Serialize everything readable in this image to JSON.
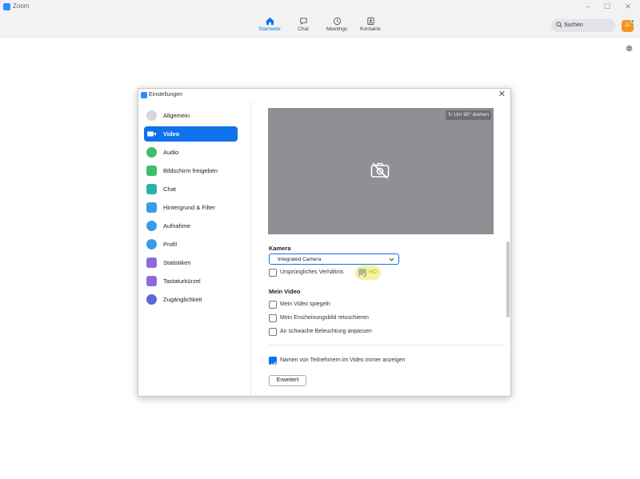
{
  "app": {
    "title": "Zoom"
  },
  "window_controls": {
    "minimize": "–",
    "maximize": "☐",
    "close": "✕"
  },
  "topnav": {
    "items": [
      {
        "label": "Startseite",
        "icon": "home-icon",
        "active": true
      },
      {
        "label": "Chat",
        "icon": "chat-icon",
        "active": false
      },
      {
        "label": "Meetings",
        "icon": "clock-icon",
        "active": false
      },
      {
        "label": "Kontakte",
        "icon": "contacts-icon",
        "active": false
      }
    ],
    "search_label": "Suchen",
    "avatar_initials": "JL"
  },
  "colors": {
    "accent": "#0e72ed",
    "brand": "#2d8cff",
    "avatar": "#f7941d",
    "online": "#20c05c",
    "highlight": "#f6f39a"
  },
  "dialog": {
    "title": "Einstellungen",
    "close": "✕",
    "sidebar": [
      {
        "label": "Allgemein",
        "icon": "gear-icon",
        "color": "#c9c9cf"
      },
      {
        "label": "Video",
        "icon": "video-camera-icon",
        "color": "#ffffff",
        "active": true
      },
      {
        "label": "Audio",
        "icon": "headphones-icon",
        "color": "#3cbf6a"
      },
      {
        "label": "Bildschirm freigeben",
        "icon": "share-screen-icon",
        "color": "#3cbf6a"
      },
      {
        "label": "Chat",
        "icon": "chat-bubble-icon",
        "color": "#2bb3a3"
      },
      {
        "label": "Hintergrund & Filter",
        "icon": "background-icon",
        "color": "#3a9be8"
      },
      {
        "label": "Aufnahme",
        "icon": "record-icon",
        "color": "#3a9be8"
      },
      {
        "label": "Profil",
        "icon": "profile-icon",
        "color": "#3a9be8"
      },
      {
        "label": "Statistiken",
        "icon": "statistics-icon",
        "color": "#8e6ad8"
      },
      {
        "label": "Tastaturkürzel",
        "icon": "keyboard-icon",
        "color": "#8e6ad8"
      },
      {
        "label": "Zugänglichkeit",
        "icon": "accessibility-icon",
        "color": "#5a68d8"
      }
    ],
    "video": {
      "rotate_label": "Um 90° drehen",
      "camera_section": "Kamera",
      "camera_selected": "Integrated Camera",
      "original_ratio": {
        "label": "Ursprüngliches Verhältnis",
        "checked": false
      },
      "hd": {
        "label": "HD",
        "checked": true
      },
      "my_video_section": "Mein Video",
      "options": [
        {
          "label": "Mein Video spiegeln",
          "checked": false
        },
        {
          "label": "Mein Erscheinungsbild retuschieren",
          "checked": false
        },
        {
          "label": "An schwache Beleuchtung anpassen",
          "checked": false
        }
      ],
      "show_names": {
        "label": "Namen von Teilnehmern im Video immer anzeigen",
        "checked": true
      },
      "advanced_button": "Erweitert"
    }
  }
}
